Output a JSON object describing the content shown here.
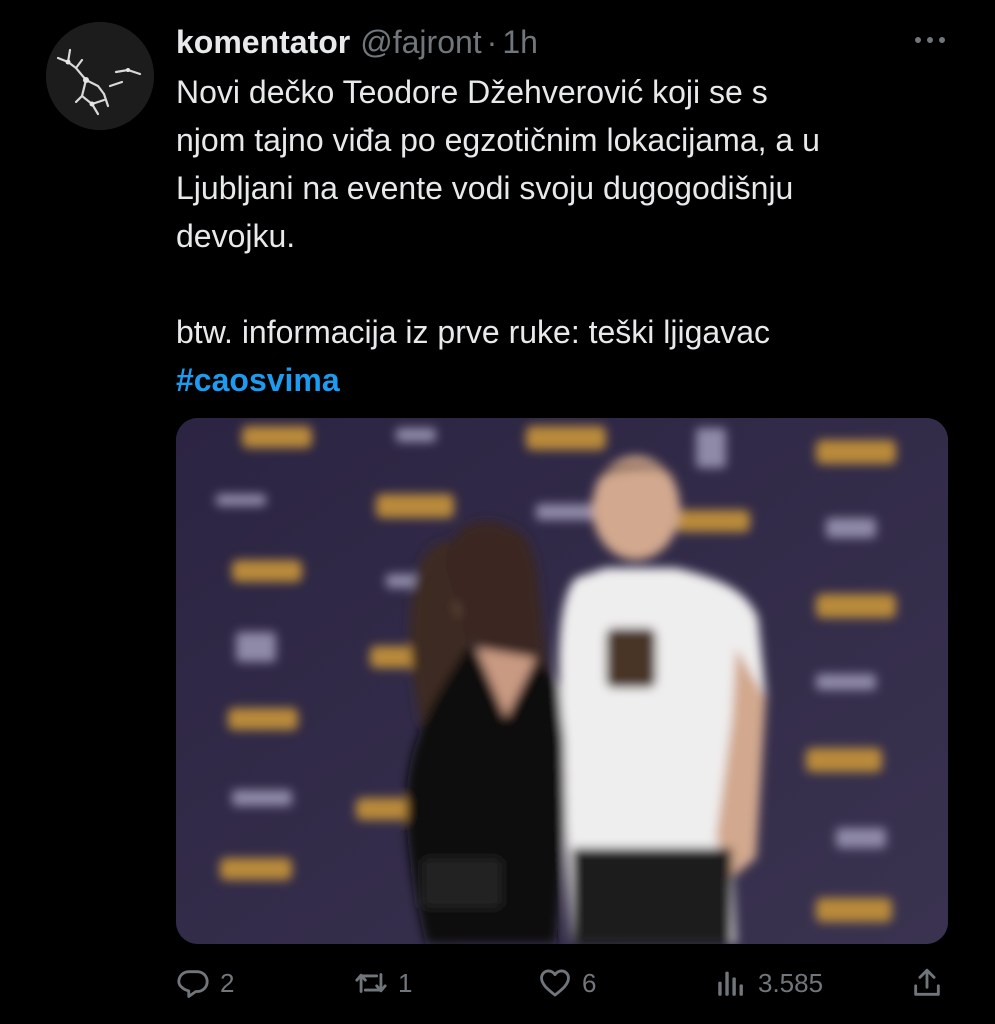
{
  "author": {
    "display_name": "komentator",
    "handle": "@fajront",
    "separator": "·",
    "time": "1h"
  },
  "tweet": {
    "lines": [
      "Novi dečko Teodore Džehverović koji se s",
      "njom tajno viđa po egzotičnim lokacijama, a u",
      "Ljubljani na evente vodi svoju dugogodišnju",
      "devojku."
    ],
    "second_paragraph": "btw. informacija iz prve ruke: teški ljigavac",
    "hashtag": "#caosvima"
  },
  "media": {
    "description_icon": "photo"
  },
  "actions": {
    "replies": "2",
    "retweets": "1",
    "likes": "6",
    "views": "3.585"
  },
  "colors": {
    "background": "#000000",
    "text": "#e7e9ea",
    "muted": "#71767b",
    "link": "#1d9bf0"
  },
  "icons": {
    "more": "more-horizontal-icon",
    "reply": "reply-icon",
    "retweet": "retweet-icon",
    "like": "heart-icon",
    "views": "views-icon",
    "share": "share-icon"
  }
}
